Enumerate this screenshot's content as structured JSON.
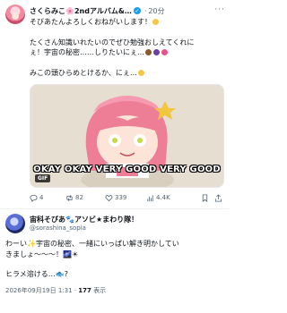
{
  "post": {
    "author_name": "さくらみこ🌸2ndアルバム&…",
    "verified_mark": "✓",
    "handle": "",
    "time": "20分",
    "more": "···",
    "line1": "そびあたんよろしくおねがいします！",
    "line2": "たくさん知識いれたいのでぜひ勉強おしえてくれに",
    "line3": "ぇ！宇宙の秘密……しりたいにぇ…",
    "line4": "みこの頭ひらめとけるか、にぇ…",
    "media": {
      "caption": "OKAY OKAY VERY GOOD VERY GOOD",
      "badge": "GIF"
    },
    "actions": {
      "reply": "4",
      "retweet": "82",
      "like": "339",
      "views": "4.4K"
    }
  },
  "reply": {
    "author_name": "宙科そびあ🐾アソビ★まわり隊！",
    "handle": "@sorashina_sopia",
    "line1": "わーい✨宇宙の秘密、一緒にいっぱい解き明かしてい",
    "line2": "きましょ〜〜〜！🌌☀",
    "line3": "ヒラメ溶ける…🐟?",
    "timestamp": "2026年09月19日 1:31",
    "views_count": "177",
    "views_label": "表示"
  },
  "colors": {
    "accent": "#1d9bf0",
    "text": "#0f1419",
    "muted": "#536471",
    "separator": "#eff3f4"
  }
}
